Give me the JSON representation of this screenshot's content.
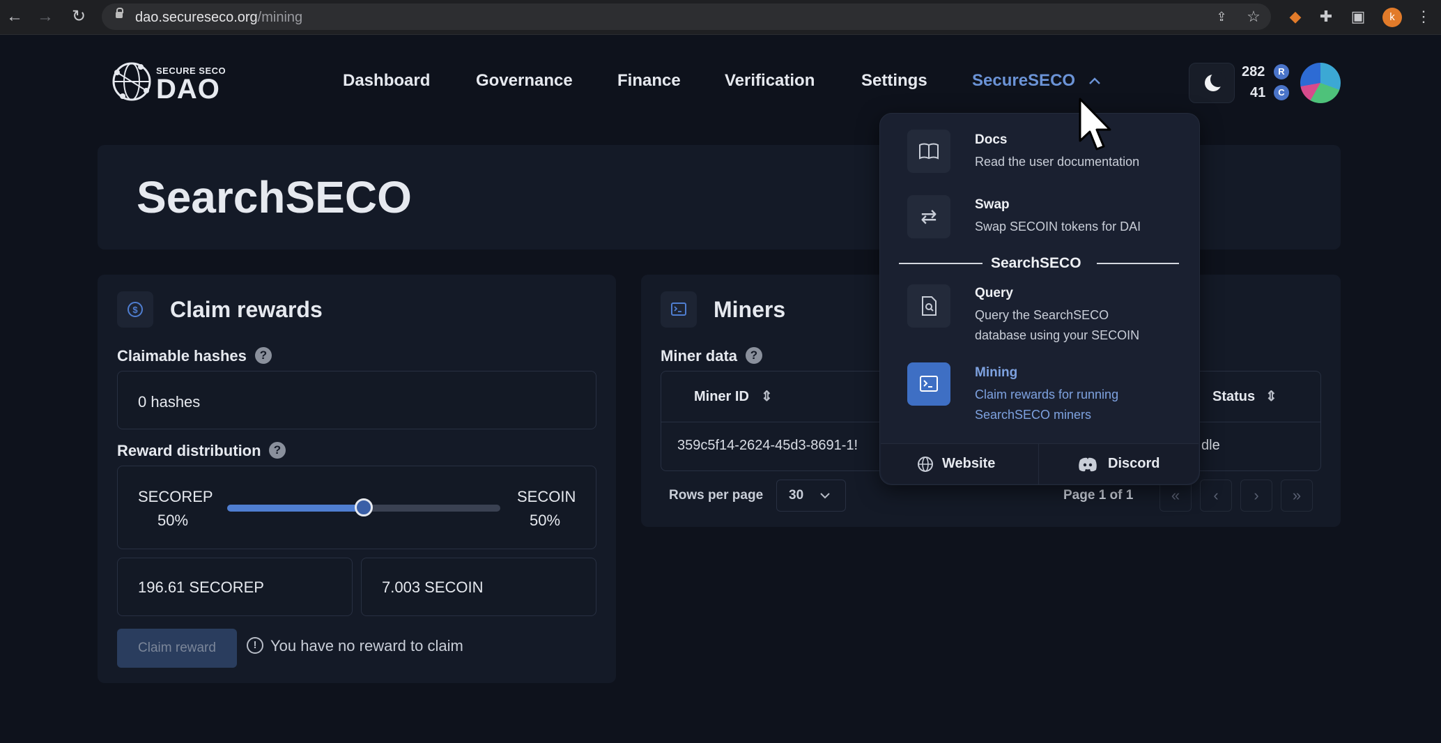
{
  "browser": {
    "url_host": "dao.secureseco.org",
    "url_path": "/mining",
    "profile_initial": "k"
  },
  "header": {
    "logo_small": "SECURE SECO",
    "logo_big": "DAO",
    "nav": [
      "Dashboard",
      "Governance",
      "Finance",
      "Verification",
      "Settings",
      "SecureSECO"
    ],
    "rep_balance": "282",
    "rep_coin": "R",
    "coin_balance": "41",
    "coin_symbol": "C"
  },
  "page": {
    "title": "SearchSECO"
  },
  "claim": {
    "title": "Claim rewards",
    "claimable_label": "Claimable hashes",
    "claimable_value": "0 hashes",
    "distribution_label": "Reward distribution",
    "left_token": "SECOREP",
    "left_percent": "50%",
    "right_token": "SECOIN",
    "right_percent": "50%",
    "slider_fraction": 0.5,
    "secorep_amount": "196.61 SECOREP",
    "secoin_amount": "7.003 SECOIN",
    "button": "Claim reward",
    "notice": "You have no reward to claim"
  },
  "miners": {
    "title": "Miners",
    "data_label": "Miner data",
    "columns": [
      "Miner ID",
      "Status"
    ],
    "rows": [
      [
        "359c5f14-2624-45d3-8691-1!",
        "Idle"
      ]
    ],
    "status_visible": "dle",
    "rows_per_page_label": "Rows per page",
    "rows_per_page": "30",
    "page_info": "Page 1 of 1"
  },
  "dropdown": {
    "docs_title": "Docs",
    "docs_desc": "Read the user documentation",
    "swap_title": "Swap",
    "swap_desc": "Swap SECOIN tokens for DAI",
    "section": "SearchSECO",
    "query_title": "Query",
    "query_desc_1": "Query the SearchSECO",
    "query_desc_2": "database using your SECOIN",
    "mining_title": "Mining",
    "mining_desc_1": "Claim rewards for running",
    "mining_desc_2": "SearchSECO miners",
    "website": "Website",
    "discord": "Discord"
  },
  "colors": {
    "accent": "#6b93d6",
    "background": "#0e121c",
    "panel": "#141a27",
    "active_item": "#3e6fc4"
  }
}
